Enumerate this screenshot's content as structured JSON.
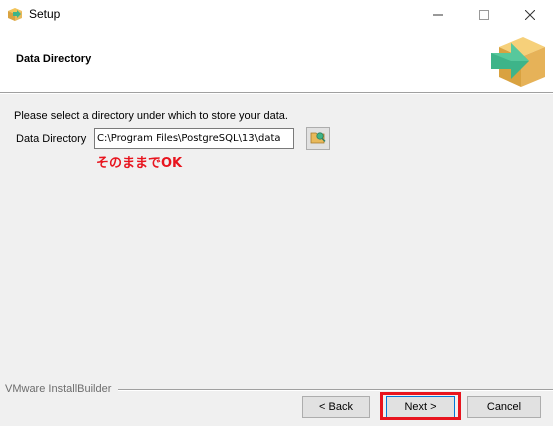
{
  "window": {
    "title": "Setup",
    "icon": "package-icon",
    "controls": {
      "minimize": "—",
      "maximize": "☐",
      "close": "✕"
    }
  },
  "header": {
    "title": "Data Directory",
    "logo_icon": "installer-logo-icon"
  },
  "main": {
    "prompt": "Please select a directory under which to store your data.",
    "dir_label": "Data Directory",
    "dir_value": "C:\\Program Files\\PostgreSQL\\13\\data",
    "browse_icon": "folder-browse-icon"
  },
  "annotation": {
    "text": "そのままでOK",
    "color": "#e8141e"
  },
  "footer": {
    "brand": "VMware InstallBuilder",
    "back_label": "< Back",
    "next_label": "Next >",
    "cancel_label": "Cancel"
  },
  "colors": {
    "highlight": "#e8141e",
    "focus_border": "#0078d7",
    "logo_green": "#3eb489",
    "logo_box": "#e8b95b"
  }
}
